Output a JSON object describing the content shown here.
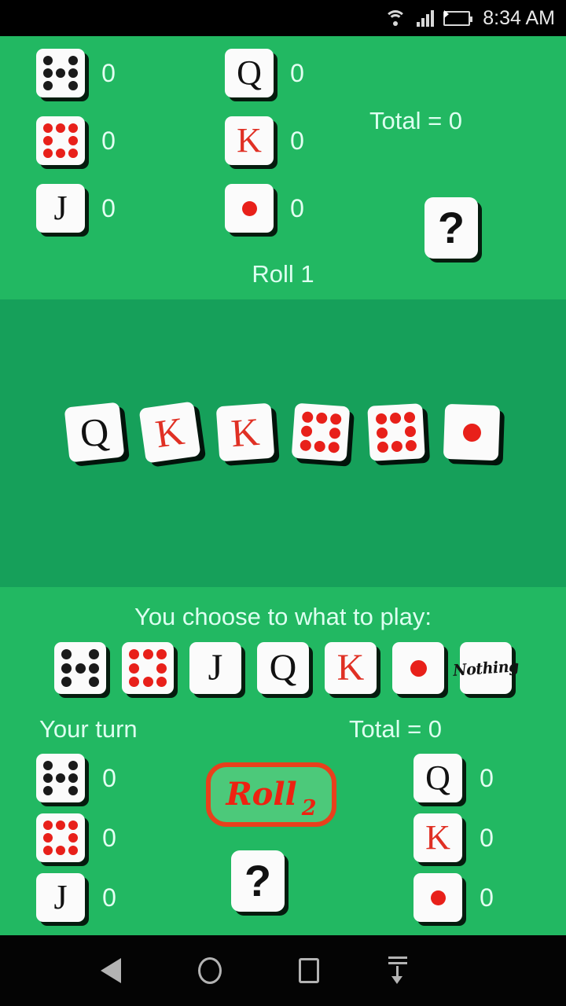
{
  "status_bar": {
    "time": "8:34 AM",
    "wifi_icon": "wifi-icon",
    "signal_icon": "signal-bars-icon",
    "battery_icon": "battery-charging-icon"
  },
  "colors": {
    "panel_top_bg": "#22b862",
    "panel_mid_bg": "#16a05a",
    "panel_bottom_bg": "#22b862",
    "text_mint": "#ddfff0",
    "pip_red": "#e8201a",
    "pip_black": "#1a1a1a",
    "roll_button_border": "#e8401c",
    "roll_button_fill": "#4cc97a",
    "roll_button_text": "#ee2211",
    "battery_fill": "#8dc63f"
  },
  "opponent_board": {
    "total_label": "Total = 0",
    "roll_label": "Roll 1",
    "mystery_label": "?",
    "column_left": [
      {
        "face": "pips-7-black",
        "pip_color": "black",
        "pip_count": 7,
        "score": "0"
      },
      {
        "face": "pips-8-red",
        "pip_color": "red",
        "pip_count": 8,
        "score": "0"
      },
      {
        "face": "letter-J",
        "letter": "J",
        "letter_color": "black",
        "score": "0"
      }
    ],
    "column_right": [
      {
        "face": "letter-Q",
        "letter": "Q",
        "letter_color": "black",
        "score": "0"
      },
      {
        "face": "letter-K",
        "letter": "K",
        "letter_color": "red",
        "score": "0"
      },
      {
        "face": "single-pip-red",
        "pip_color": "red",
        "pip_count": 1,
        "score": "0"
      }
    ]
  },
  "rolled_dice": [
    {
      "face": "letter-Q",
      "letter": "Q",
      "letter_color": "black",
      "rotation": -6
    },
    {
      "face": "letter-K",
      "letter": "K",
      "letter_color": "red",
      "rotation": -8
    },
    {
      "face": "letter-K",
      "letter": "K",
      "letter_color": "red",
      "rotation": -4
    },
    {
      "face": "pips-8-red",
      "pip_color": "red",
      "pip_count": 8,
      "rotation": 4
    },
    {
      "face": "pips-8-red",
      "pip_color": "red",
      "pip_count": 8,
      "rotation": -3
    },
    {
      "face": "single-pip-red",
      "pip_color": "red",
      "pip_count": 1,
      "rotation": 2
    }
  ],
  "player_section": {
    "choose_prompt": "You choose to what to play:",
    "turn_label": "Your turn",
    "total_label": "Total = 0",
    "roll_button": {
      "word": "Roll",
      "number": "2"
    },
    "mystery_label": "?",
    "choices": [
      {
        "face": "pips-7-black",
        "label": "",
        "pip_color": "black",
        "pip_count": 7
      },
      {
        "face": "pips-8-red",
        "label": "",
        "pip_color": "red",
        "pip_count": 8
      },
      {
        "face": "letter-J",
        "label": "J",
        "letter_color": "black"
      },
      {
        "face": "letter-Q",
        "label": "Q",
        "letter_color": "black"
      },
      {
        "face": "letter-K",
        "label": "K",
        "letter_color": "red"
      },
      {
        "face": "single-pip-red",
        "label": "",
        "pip_color": "red",
        "pip_count": 1
      },
      {
        "face": "text-nothing",
        "label": "Nothing"
      }
    ],
    "column_left": [
      {
        "face": "pips-7-black",
        "pip_color": "black",
        "pip_count": 7,
        "score": "0"
      },
      {
        "face": "pips-8-red",
        "pip_color": "red",
        "pip_count": 8,
        "score": "0"
      },
      {
        "face": "letter-J",
        "letter": "J",
        "letter_color": "black",
        "score": "0"
      }
    ],
    "column_right": [
      {
        "face": "letter-Q",
        "letter": "Q",
        "letter_color": "black",
        "score": "0"
      },
      {
        "face": "letter-K",
        "letter": "K",
        "letter_color": "red",
        "score": "0"
      },
      {
        "face": "single-pip-red",
        "pip_color": "red",
        "pip_count": 1,
        "score": "0"
      }
    ]
  },
  "nav_bar": {
    "back_icon": "back-triangle-icon",
    "home_icon": "home-circle-icon",
    "recents_icon": "recents-square-icon",
    "hide_icon": "hide-keyboard-icon"
  }
}
